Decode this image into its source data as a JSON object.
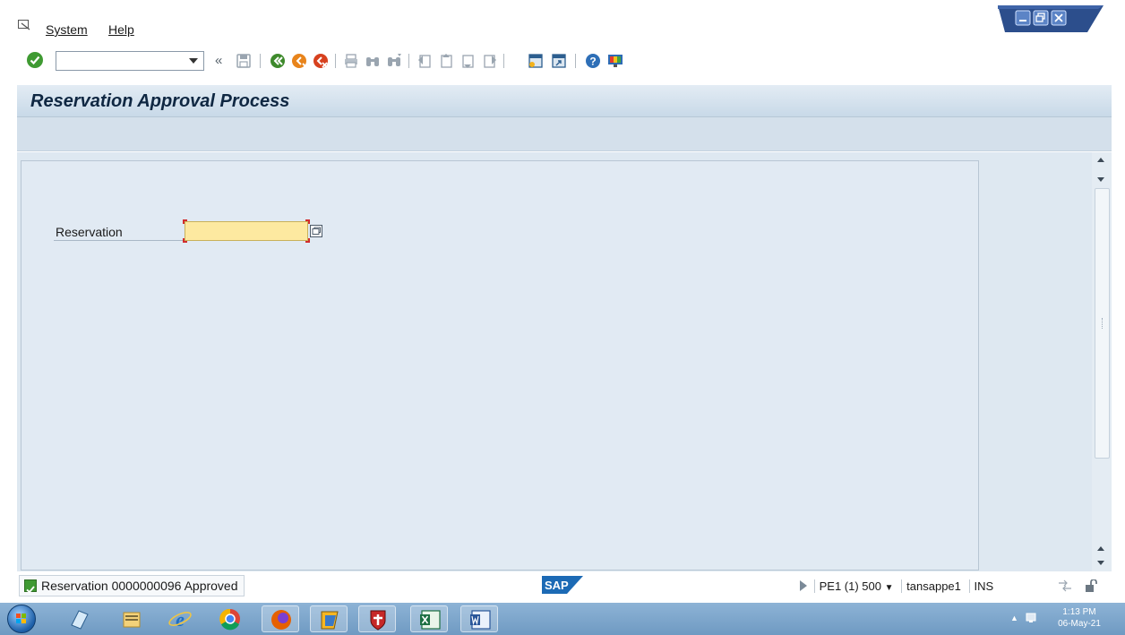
{
  "menu": {
    "items": [
      {
        "label": "System"
      },
      {
        "label": "Help"
      }
    ]
  },
  "toolbar": {
    "command_field_value": "",
    "buttons": [
      "enter-icon",
      "back-history-icon",
      "save-icon",
      "back-icon",
      "exit-icon",
      "cancel-icon",
      "print-icon",
      "find-icon",
      "find-next-icon",
      "first-page-icon",
      "previous-page-icon",
      "next-page-icon",
      "last-page-icon",
      "create-session-icon",
      "shortcut-icon",
      "help-icon",
      "customize-layout-icon"
    ]
  },
  "screen": {
    "title": "Reservation Approval Process"
  },
  "form": {
    "reservation_label": "Reservation",
    "reservation_value": ""
  },
  "status": {
    "message": "Reservation 0000000096 Approved",
    "system": "PE1 (1) 500",
    "user": "tansappe1",
    "mode": "INS"
  },
  "taskbar": {
    "apps": [
      "windows-explorer-icon",
      "file-manager-icon",
      "internet-explorer-icon",
      "chrome-icon",
      "firefox-icon",
      "sap-logon-icon",
      "shield-app-icon",
      "excel-icon",
      "word-icon"
    ],
    "time": "1:13 PM",
    "date": "06-May-21"
  },
  "colors": {
    "title_band": "#c8d9e8",
    "main_background": "#dee8f1",
    "required_input": "#fde9a0",
    "taskbar": "#7ea7cd",
    "success_green": "#3f9a32"
  }
}
